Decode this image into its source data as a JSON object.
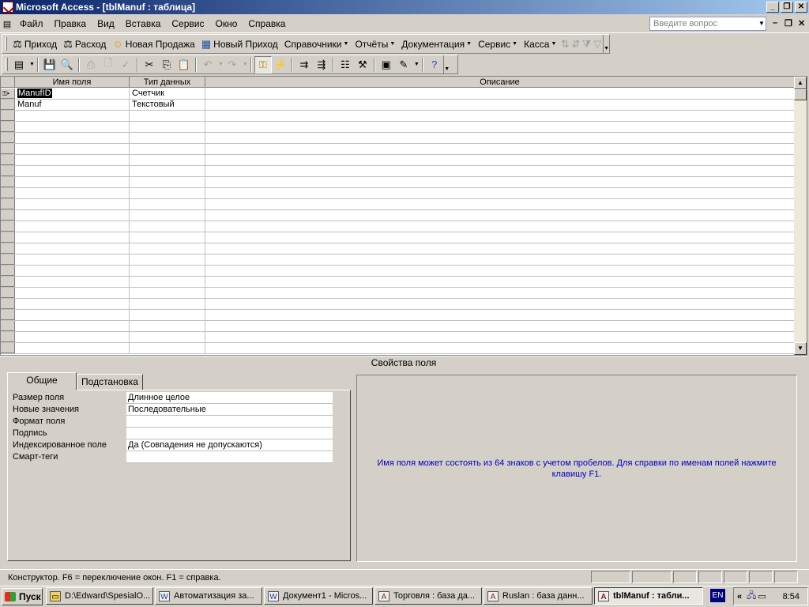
{
  "window": {
    "title": "Microsoft Access - [tblManuf : таблица]"
  },
  "menu": {
    "items": [
      "Файл",
      "Правка",
      "Вид",
      "Вставка",
      "Сервис",
      "Окно",
      "Справка"
    ],
    "help_placeholder": "Введите вопрос"
  },
  "toolbar1": {
    "items": [
      {
        "label": "Приход",
        "icon": "scale-icon"
      },
      {
        "label": "Расход",
        "icon": "scale-icon"
      },
      {
        "label": "Новая Продажа",
        "icon": "smiley-icon"
      },
      {
        "label": "Новый Приход",
        "icon": "table-icon"
      },
      {
        "label": "Справочники",
        "dropdown": true
      },
      {
        "label": "Отчёты",
        "dropdown": true
      },
      {
        "label": "Документация",
        "dropdown": true
      },
      {
        "label": "Сервис",
        "dropdown": true
      },
      {
        "label": "Касса",
        "dropdown": true
      }
    ]
  },
  "grid": {
    "headers": [
      "Имя поля",
      "Тип данных",
      "Описание"
    ],
    "rows": [
      {
        "name": "ManufID",
        "type": "Счетчик",
        "desc": ""
      },
      {
        "name": "Manuf",
        "type": "Текстовый",
        "desc": ""
      }
    ]
  },
  "properties": {
    "caption": "Свойства поля",
    "tabs": [
      "Общие",
      "Подстановка"
    ],
    "fields": [
      {
        "label": "Размер поля",
        "value": "Длинное целое"
      },
      {
        "label": "Новые значения",
        "value": "Последовательные"
      },
      {
        "label": "Формат поля",
        "value": ""
      },
      {
        "label": "Подпись",
        "value": ""
      },
      {
        "label": "Индексированное поле",
        "value": "Да (Совпадения не допускаются)"
      },
      {
        "label": "Смарт-теги",
        "value": ""
      }
    ],
    "help_text": "Имя поля может состоять из 64 знаков с учетом пробелов.  Для справки по именам полей нажмите клавишу F1."
  },
  "status": {
    "text": "Конструктор.  F6 = переключение окон.  F1 = справка."
  },
  "taskbar": {
    "start": "Пуск",
    "tasks": [
      {
        "label": "D:\\Edward\\SpesialO...",
        "icon": "folder-icon"
      },
      {
        "label": "Автоматизация за...",
        "icon": "word-icon"
      },
      {
        "label": "Документ1 - Micros...",
        "icon": "word-icon"
      },
      {
        "label": "Торговля : база да...",
        "icon": "access-icon"
      },
      {
        "label": "Ruslan : база данн...",
        "icon": "access-icon"
      },
      {
        "label": "tblManuf : табли...",
        "icon": "access-icon",
        "active": true
      }
    ],
    "lang": "EN",
    "clock": "8:54"
  }
}
